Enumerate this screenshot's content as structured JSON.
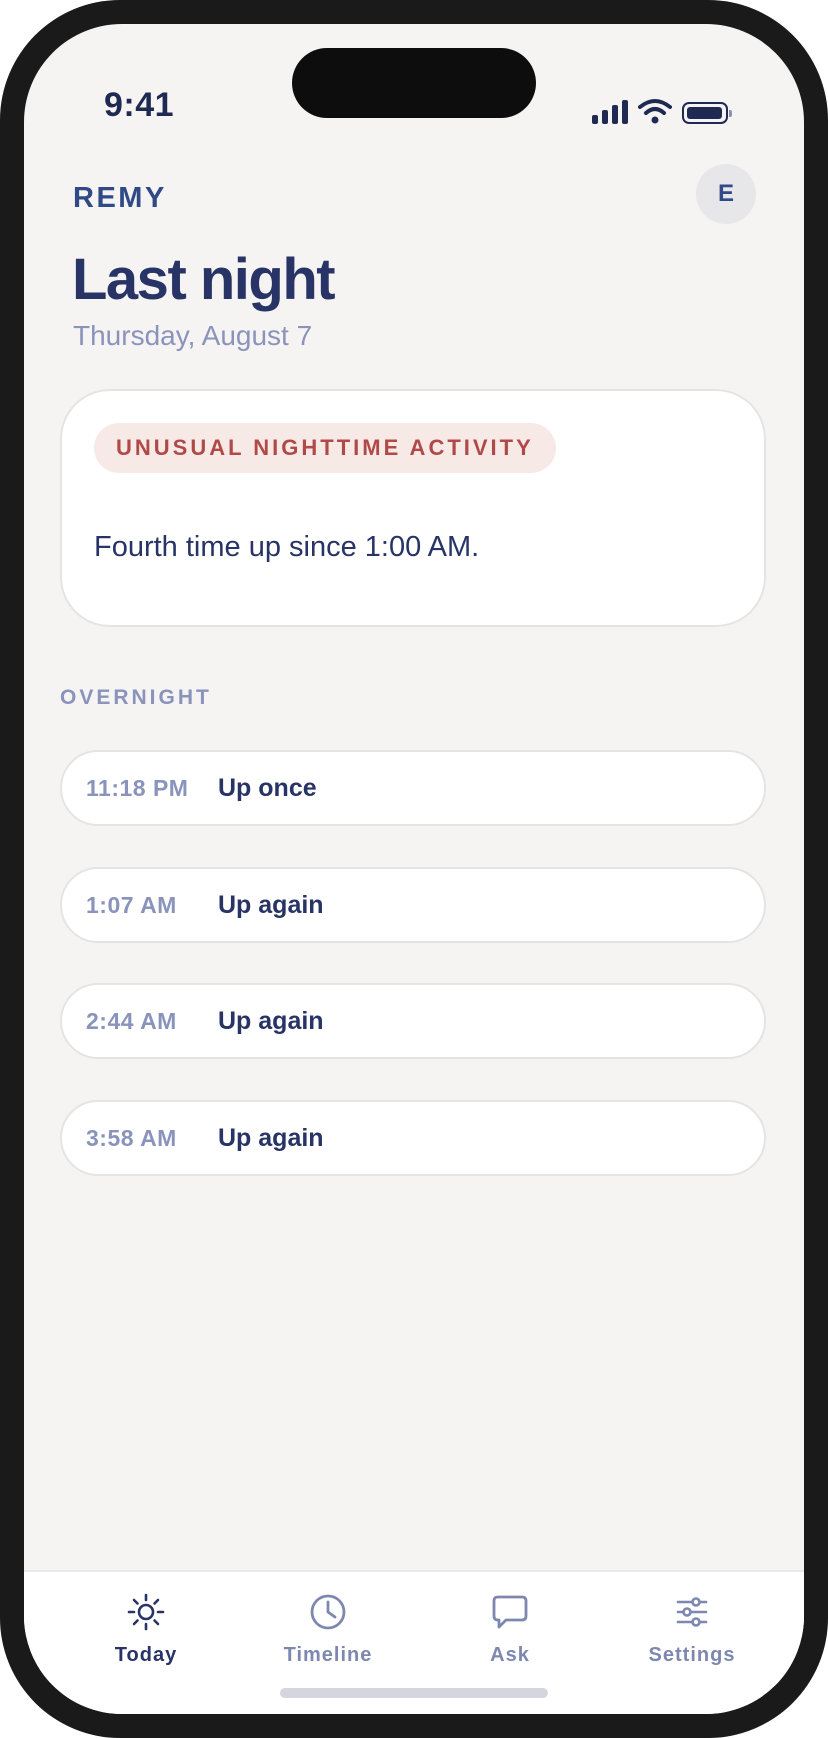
{
  "status_bar": {
    "time": "9:41",
    "icons": [
      "signal-icon",
      "wifi-icon",
      "battery-icon"
    ]
  },
  "header": {
    "brand": "REMY",
    "avatar_initial": "E",
    "title": "Last night",
    "date": "Thursday, August 7"
  },
  "alert": {
    "badge": "UNUSUAL NIGHTTIME ACTIVITY",
    "message": "Fourth time up since 1:00 AM."
  },
  "overnight": {
    "label": "OVERNIGHT",
    "events": [
      {
        "time": "11:18 PM",
        "description": "Up once"
      },
      {
        "time": "1:07 AM",
        "description": "Up again"
      },
      {
        "time": "2:44 AM",
        "description": "Up again"
      },
      {
        "time": "3:58 AM",
        "description": "Up again"
      }
    ]
  },
  "tabs": [
    {
      "label": "Today",
      "icon": "sun-icon",
      "active": true
    },
    {
      "label": "Timeline",
      "icon": "clock-icon",
      "active": false
    },
    {
      "label": "Ask",
      "icon": "chat-bubble-icon",
      "active": false
    },
    {
      "label": "Settings",
      "icon": "sliders-icon",
      "active": false
    }
  ],
  "colors": {
    "background": "#f6f4f3",
    "primary_text": "#283366",
    "muted_text": "#8a93bc",
    "alert_text": "#b04a48",
    "alert_background": "#f7e9e6"
  }
}
